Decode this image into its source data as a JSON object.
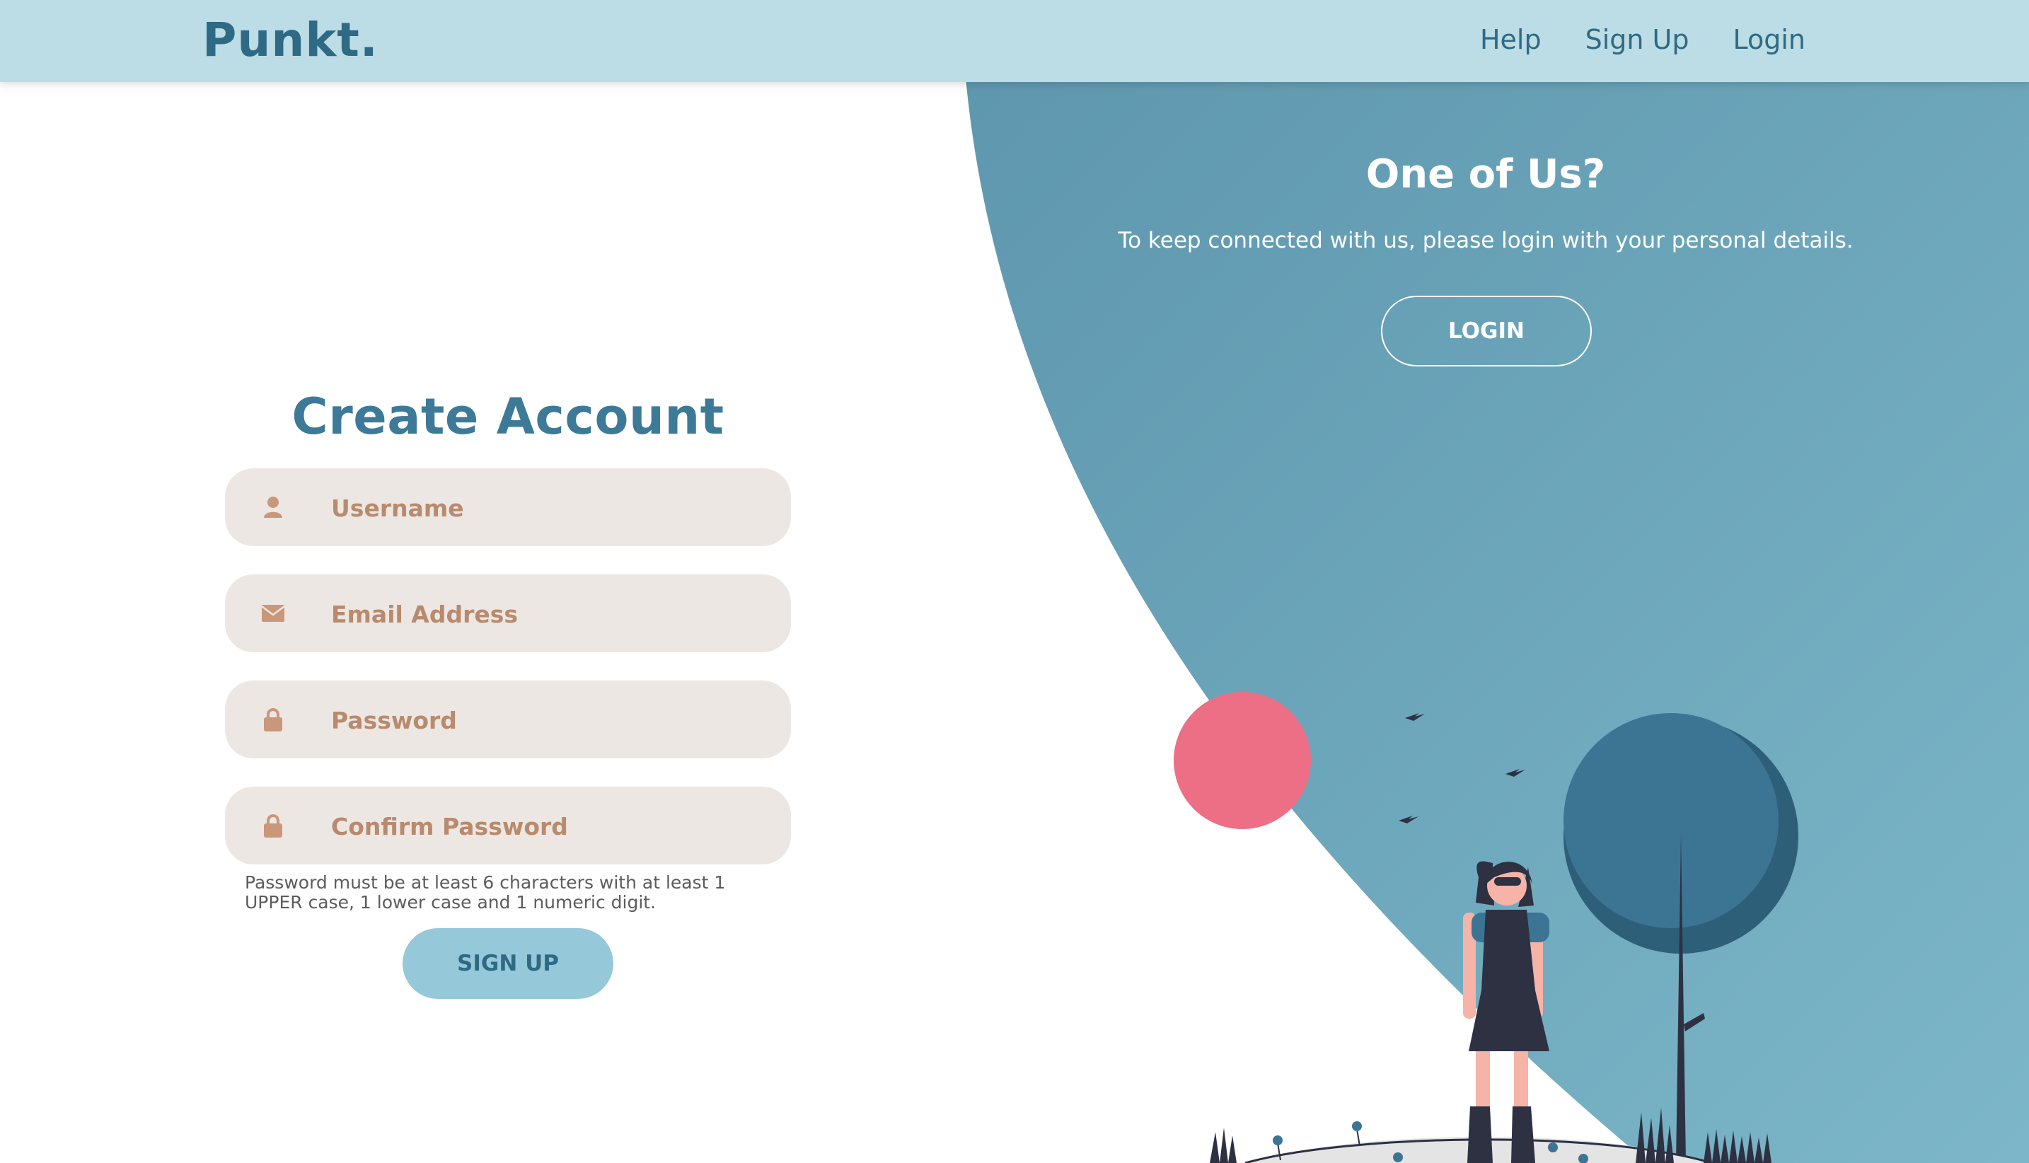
{
  "nav": {
    "brand": "Punkt.",
    "links": [
      "Help",
      "Sign Up",
      "Login"
    ]
  },
  "panel": {
    "title": "One of Us?",
    "text": "To keep connected with us, please login with your personal details.",
    "login_button": "LOGIN"
  },
  "form": {
    "title": "Create Account",
    "fields": [
      {
        "placeholder": "Username",
        "icon": "user-icon"
      },
      {
        "placeholder": "Email Address",
        "icon": "envelope-icon"
      },
      {
        "placeholder": "Password",
        "icon": "lock-icon"
      },
      {
        "placeholder": "Confirm Password",
        "icon": "lock-icon"
      }
    ],
    "hint": "Password must be at least 6 characters with at least 1 UPPER case, 1 lower case and 1 numeric digit.",
    "submit": "SIGN UP"
  },
  "colors": {
    "navbar": "#bcdde5",
    "brand": "#2f6a85",
    "panel": "#6aa5b9",
    "field_bg": "#ede7e3",
    "placeholder": "#b88a6e",
    "signup_button": "#95c9d9",
    "pink_circle": "#ed6f85"
  }
}
